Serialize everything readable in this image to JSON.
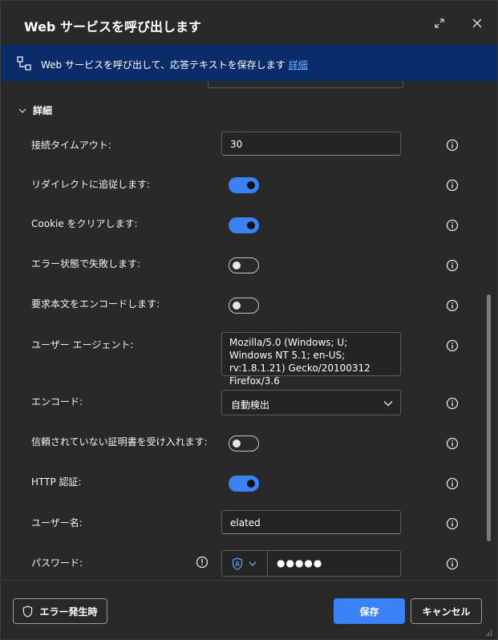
{
  "dialog": {
    "title": "Web サービスを呼び出します",
    "banner_text": "Web サービスを呼び出して、応答テキストを保存します",
    "banner_link": "詳細"
  },
  "section": {
    "label": "詳細",
    "expanded": true
  },
  "fields": {
    "timeout": {
      "label": "接続タイムアウト:",
      "value": "30"
    },
    "follow_redirects": {
      "label": "リダイレクトに追従します:",
      "on": true
    },
    "clear_cookies": {
      "label": "Cookie をクリアします:",
      "on": true
    },
    "fail_on_error": {
      "label": "エラー状態で失敗します:",
      "on": false
    },
    "encode_body": {
      "label": "要求本文をエンコードします:",
      "on": false
    },
    "user_agent": {
      "label": "ユーザー エージェント:",
      "value": "Mozilla/5.0 (Windows; U; Windows NT 5.1; en-US; rv:1.8.1.21) Gecko/20100312 Firefox/3.6"
    },
    "encoding": {
      "label": "エンコード:",
      "value": "自動検出"
    },
    "accept_untrusted": {
      "label": "信頼されていない証明書を受け入れます:",
      "on": false
    },
    "http_auth": {
      "label": "HTTP 認証:",
      "on": true
    },
    "username": {
      "label": "ユーザー名:",
      "value": "elated"
    },
    "password": {
      "label": "パスワード:",
      "value": "●●●●●"
    }
  },
  "footer": {
    "error_button": "エラー発生時",
    "save_button": "保存",
    "cancel_button": "キャンセル"
  },
  "colors": {
    "accent": "#3b82f6",
    "banner": "#0a2c6b",
    "background": "#292929",
    "link": "#6cb0ff"
  },
  "icons": [
    "expand-icon",
    "close-icon",
    "flow-icon",
    "chevron-down-icon",
    "info-icon",
    "shield-icon",
    "warning-icon"
  ]
}
